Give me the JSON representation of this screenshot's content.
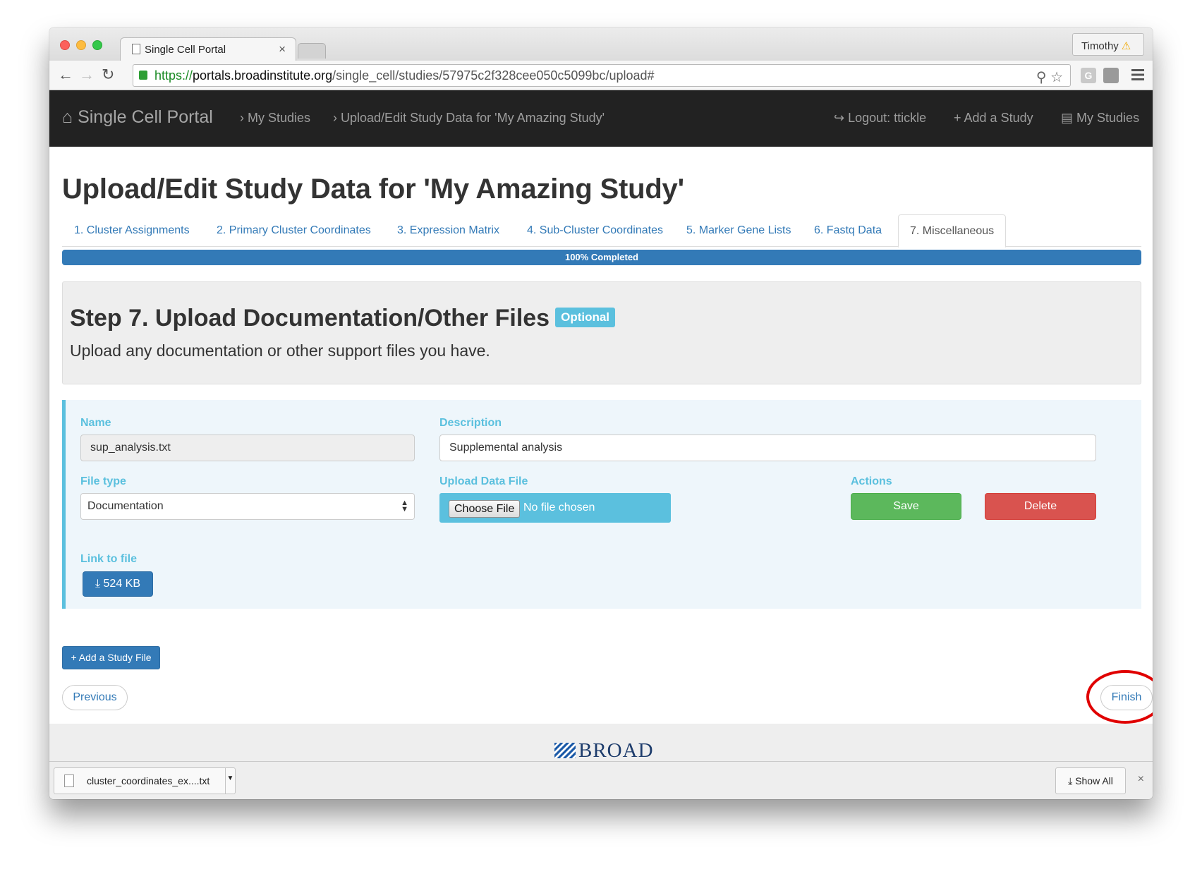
{
  "browser": {
    "tab_title": "Single Cell Portal",
    "tab_close": "×",
    "profile_name": "Timothy",
    "profile_warning": "⚠",
    "url_scheme": "https://",
    "url_host": "portals.broadinstitute.org",
    "url_path": "/single_cell/studies/57975c2f328cee050c5099bc/upload#",
    "ext1": "G"
  },
  "navbar": {
    "brand": "Single Cell Portal",
    "crumb1": "My Studies",
    "crumb2": "Upload/Edit Study Data for 'My Amazing Study'",
    "logout": "Logout: ttickle",
    "add_study": "Add a Study",
    "my_studies": "My Studies"
  },
  "page": {
    "title": "Upload/Edit Study Data for 'My Amazing Study'",
    "tabs": [
      {
        "label": "1. Cluster Assignments"
      },
      {
        "label": "2. Primary Cluster Coordinates"
      },
      {
        "label": "3. Expression Matrix"
      },
      {
        "label": "4. Sub-Cluster Coordinates"
      },
      {
        "label": "5. Marker Gene Lists"
      },
      {
        "label": "6. Fastq Data"
      },
      {
        "label": "7. Miscellaneous"
      }
    ],
    "active_tab": "7. Miscellaneous",
    "progress_label": "100% Completed",
    "progress_value": 100
  },
  "step": {
    "heading": "Step 7. Upload Documentation/Other Files",
    "badge": "Optional",
    "description": "Upload any documentation or other support files you have."
  },
  "file": {
    "name_label": "Name",
    "name_value": "sup_analysis.txt",
    "description_label": "Description",
    "description_value": "Supplemental analysis",
    "file_type_label": "File type",
    "file_type_value": "Documentation",
    "upload_label": "Upload Data File",
    "choose_file": "Choose File",
    "no_file": "No file chosen",
    "actions_label": "Actions",
    "save": "Save",
    "delete": "Delete",
    "link_label": "Link to file",
    "download_size": "524 KB"
  },
  "buttons": {
    "add_study_file": "Add a Study File",
    "previous": "Previous",
    "finish": "Finish"
  },
  "footer": {
    "logo_text": "BROAD"
  },
  "downloads": {
    "file_name": "cluster_coordinates_ex....txt",
    "show_all": "Show All",
    "close": "×"
  }
}
